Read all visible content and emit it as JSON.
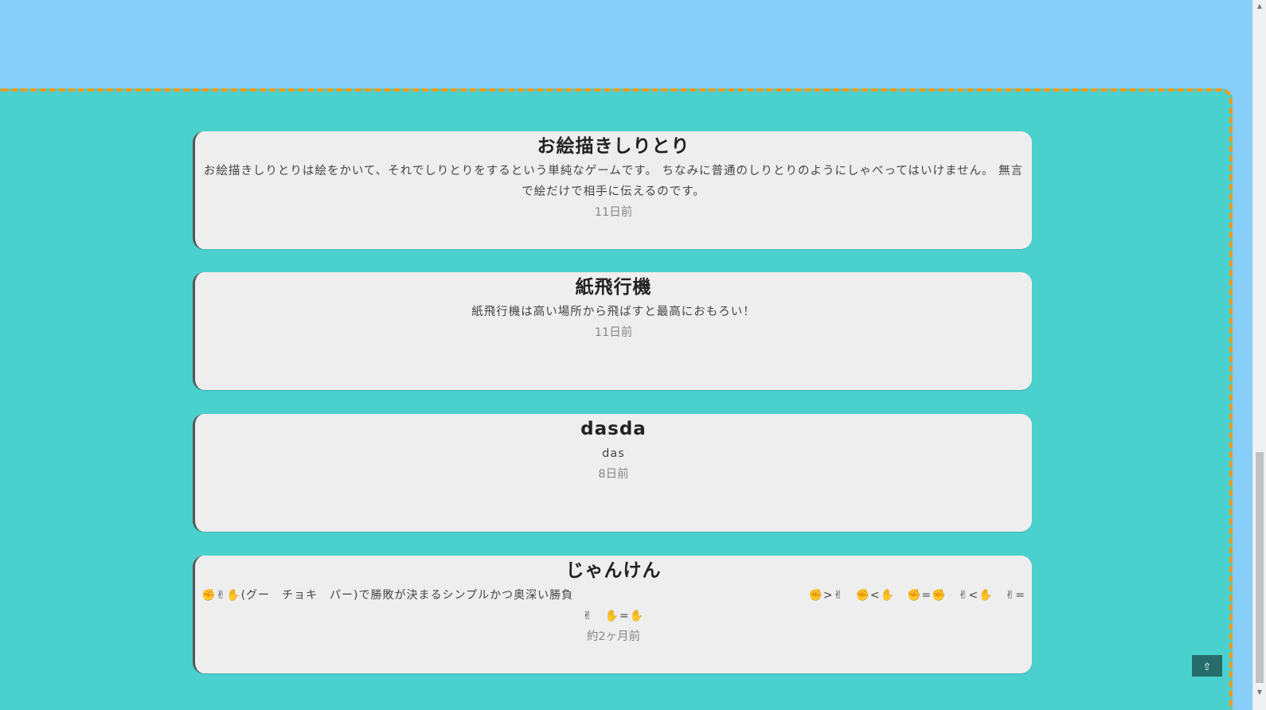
{
  "posts": [
    {
      "title": "お絵描きしりとり",
      "desc_line1": "お絵描きしりとりは絵をかいて、それでしりとりをするという単純なゲームです。 ちなみに普通のしりとりのようにしゃべってはいけません。 無言",
      "desc_line2": "で絵だけで相手に伝えるのです。",
      "time": "11日前"
    },
    {
      "title": "紙飛行機",
      "desc_line1": "紙飛行機は高い場所から飛ばすと最高におもろい！",
      "time": "11日前"
    },
    {
      "title": "dasda",
      "desc_line1": "das",
      "time": "8日前"
    },
    {
      "title": "じゃんけん",
      "desc_left": "✊✌✋(グー　チョキ　パー)で勝敗が決まるシンプルかつ奥深い勝負",
      "desc_right": "✊>✌　✊<✋　✊=✊　✌<✋　✌=",
      "desc_line2": "✌　✋=✋",
      "time": "約2ヶ月前"
    }
  ],
  "page_top_label": "⇧",
  "scroll_up": "▲",
  "scroll_down": "▼"
}
